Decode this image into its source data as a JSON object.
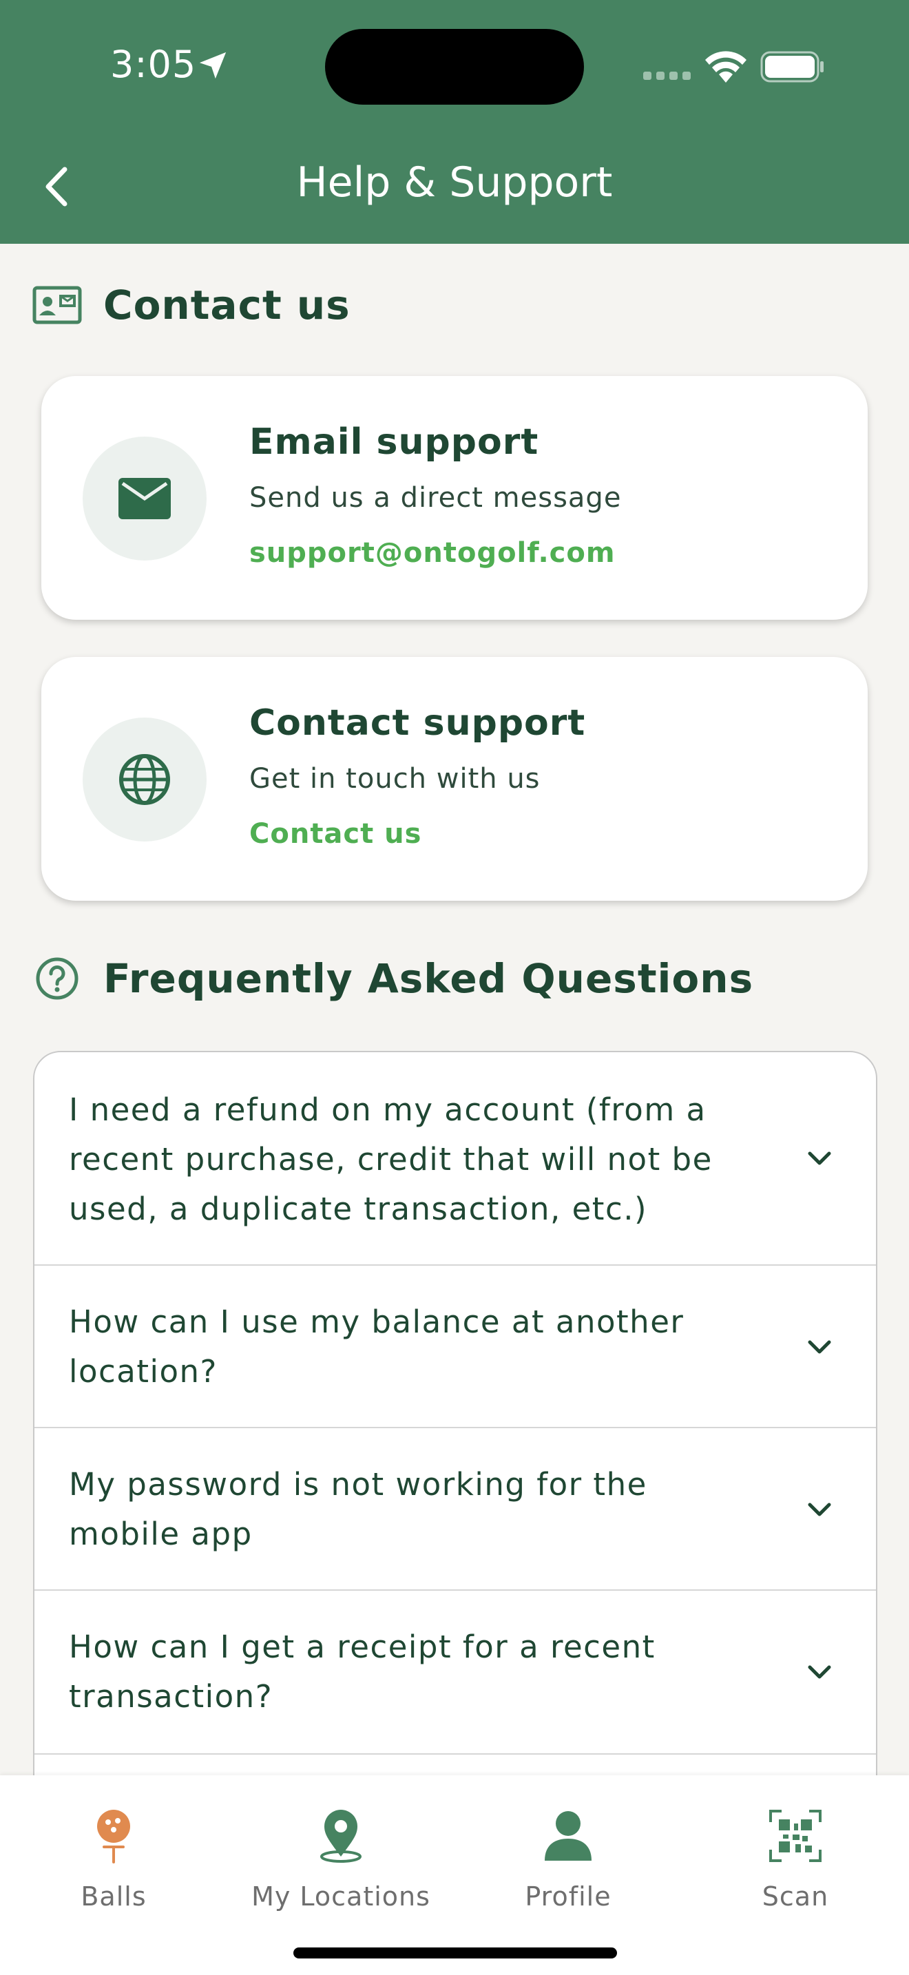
{
  "status_bar": {
    "time": "3:05"
  },
  "header": {
    "title": "Help & Support"
  },
  "contact_section": {
    "title": "Contact us",
    "cards": [
      {
        "title": "Email support",
        "subtitle": "Send us a direct message",
        "link": "support@ontogolf.com",
        "icon": "envelope-icon"
      },
      {
        "title": "Contact support",
        "subtitle": "Get in touch with us",
        "link": "Contact us",
        "icon": "globe-icon"
      }
    ]
  },
  "faq_section": {
    "title": "Frequently Asked Questions",
    "items": [
      {
        "question": "I need a refund on my account (from a recent purchase, credit that will not be used, a duplicate transaction, etc.)"
      },
      {
        "question": "How can I use my balance at another location?"
      },
      {
        "question": "My password is not working for the mobile app"
      },
      {
        "question": "How can I get a receipt for a recent transaction?"
      }
    ]
  },
  "tab_bar": {
    "tabs": [
      {
        "label": "Balls",
        "icon": "golf-ball-tee-icon"
      },
      {
        "label": "My Locations",
        "icon": "map-pin-icon"
      },
      {
        "label": "Profile",
        "icon": "person-icon"
      },
      {
        "label": "Scan",
        "icon": "qr-scan-icon"
      }
    ]
  },
  "colors": {
    "header_bg": "#468361",
    "accent_link": "#4FAE52",
    "text_dark_green": "#1F4733",
    "balls_tab": "#E08A4F"
  }
}
